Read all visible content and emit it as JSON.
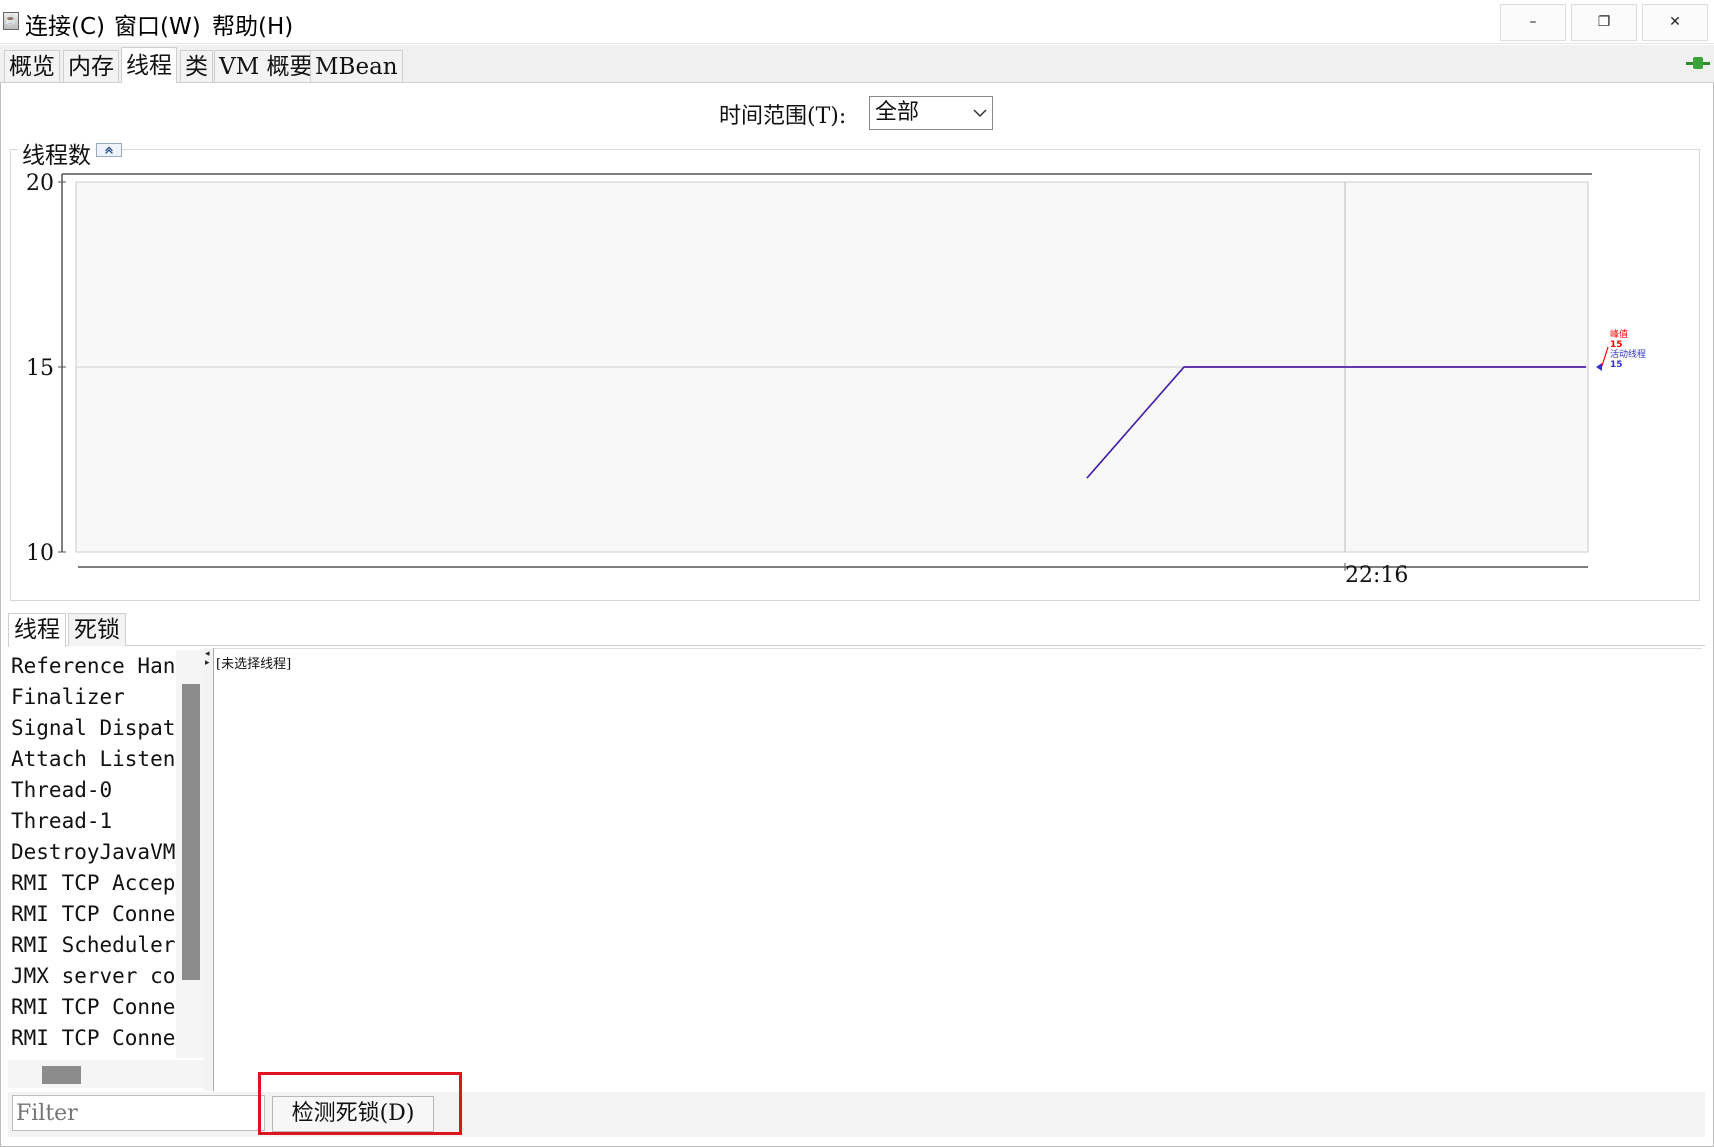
{
  "menu": {
    "items": [
      "连接(C)",
      "窗口(W)",
      "帮助(H)"
    ]
  },
  "window_controls": {
    "minimize": "–",
    "restore": "❐",
    "close": "✕"
  },
  "tabs": [
    "概览",
    "内存",
    "线程",
    "类",
    "VM 概要",
    "MBean"
  ],
  "selected_tab": "线程",
  "time_range": {
    "label": "时间范围(T):",
    "value": "全部"
  },
  "panel_title": "线程数",
  "chart_data": {
    "type": "line",
    "title": "线程数",
    "ylim": [
      10,
      20
    ],
    "y_ticks": [
      "10",
      "15",
      "20"
    ],
    "x_tick": "22:16",
    "series": [
      {
        "name": "峰值",
        "color": "#ff0000",
        "x": [
          0,
          1,
          2
        ],
        "values": [
          12,
          15,
          15
        ]
      },
      {
        "name": "活动线程",
        "color": "#3333cc",
        "x": [
          0,
          1,
          2
        ],
        "values": [
          12,
          15,
          15
        ]
      }
    ],
    "legend": [
      {
        "name": "峰值",
        "value": "15",
        "color": "#ff0000"
      },
      {
        "name": "活动线程",
        "value": "15",
        "color": "#3333cc"
      }
    ],
    "legend_position": "right",
    "grid": true
  },
  "lower_tabs": [
    "线程",
    "死锁"
  ],
  "threads": [
    "Reference Handler",
    "Finalizer",
    "Signal Dispatcher",
    "Attach Listener",
    "Thread-0",
    "Thread-1",
    "DestroyJavaVM",
    "RMI TCP Accept",
    "RMI TCP Connection",
    "RMI Scheduler",
    "JMX server connection",
    "RMI TCP Connection",
    "RMI TCP Connection"
  ],
  "detail_text": "[未选择线程]",
  "filter_placeholder": "Filter",
  "detect_button": "检测死锁(D)"
}
